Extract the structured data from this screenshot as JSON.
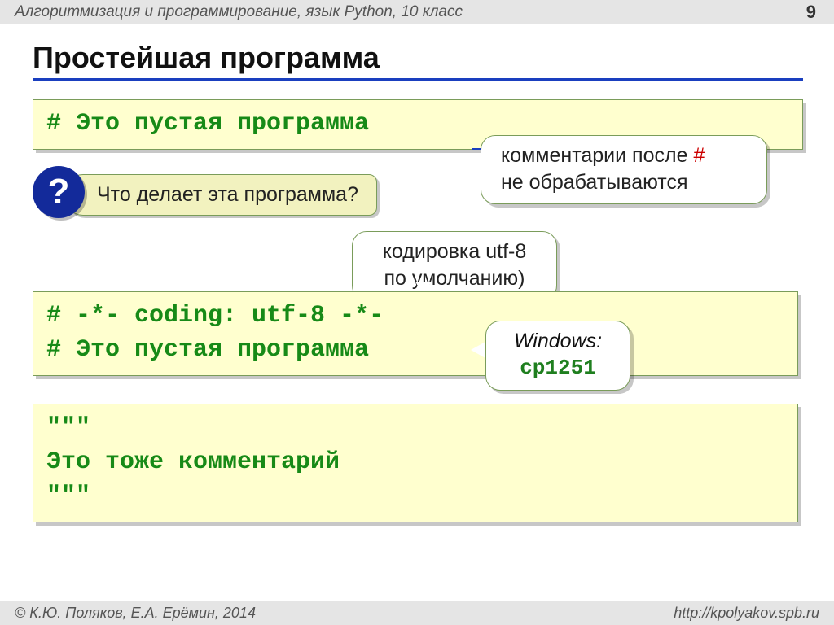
{
  "header": {
    "breadcrumb": "Алгоритмизация и программирование, язык Python, 10 класс",
    "page": "9"
  },
  "title": "Простейшая программа",
  "code1": {
    "line1": "# Это пустая программа"
  },
  "question": {
    "mark": "?",
    "text": "Что делает эта программа?"
  },
  "callout_hash": {
    "line1_pre": "комментарии после ",
    "hash": "#",
    "line2": "не обрабатываются"
  },
  "callout_utf": {
    "line1": "кодировка utf-8",
    "line2": "по умолчанию)"
  },
  "code2": {
    "line1": "# -*- coding: utf-8 -*-",
    "line2": "# Это пустая программа"
  },
  "callout_win": {
    "line1": "Windows:",
    "line2": "cp1251"
  },
  "code3": {
    "line1": "\"\"\"",
    "line2": "Это тоже комментарий",
    "line3": "\"\"\""
  },
  "footer": {
    "authors": "К.Ю. Поляков, Е.А. Ерёмин, 2014",
    "site": "http://kpolyakov.spb.ru"
  }
}
